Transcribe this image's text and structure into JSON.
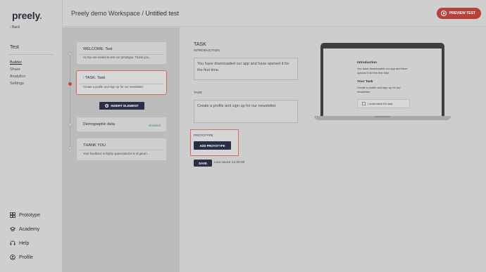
{
  "app": {
    "logo": "preely"
  },
  "sidebar": {
    "back_label": "Back",
    "project_name": "Test",
    "nav": [
      {
        "label": "Builder",
        "active": true
      },
      {
        "label": "Share",
        "active": false
      },
      {
        "label": "Analytics",
        "active": false
      },
      {
        "label": "Settings",
        "active": false
      }
    ],
    "bottom": [
      {
        "label": "Prototype",
        "icon": "grid-icon"
      },
      {
        "label": "Academy",
        "icon": "graduation-cap-icon"
      },
      {
        "label": "Help",
        "icon": "headset-icon"
      },
      {
        "label": "Profile",
        "icon": "user-icon"
      }
    ]
  },
  "header": {
    "workspace": "Preely demo Workspace /",
    "test_name": "Untitled test",
    "preview_label": "PREVIEW TEST"
  },
  "builder": {
    "cards": [
      {
        "title": "WELCOME:  Test",
        "desc": "Hi,You are invited to test our prototype. Thank you..."
      },
      {
        "title": "TASK:  Task",
        "desc": "Create a profile and sign up for our newsletter."
      },
      {
        "title": "Demographic data",
        "status": "Enabled"
      },
      {
        "title": "THANK YOU",
        "desc": "Your feedback is highly appreciated.It is of great i..."
      }
    ],
    "insert_label": "INSERT ELEMENT"
  },
  "main": {
    "heading": "TASK",
    "intro_label": "INTRODUCTION",
    "intro_text": "You have downloaded our app and have opened it for the first time.",
    "task_label": "TASK",
    "task_text": "Create a profile and sign up for our newsletter.",
    "prototype_label": "PROTOTYPE",
    "add_prototype_label": "ADD PROTOTYPE",
    "save_label": "SAVE",
    "last_saved": "Last saved 12:39:00"
  },
  "preview": {
    "intro_title": "Introduction",
    "intro_text": "You have downloaded our app and have opened it for the first time.",
    "task_title": "Your Task",
    "task_text": "Create a profile and sign up for our newsletter.",
    "checkbox_label": "I understand the task"
  },
  "colors": {
    "accent": "#c64a3e",
    "primary_dark": "#2b2f45",
    "enabled": "#3f8e5b"
  }
}
